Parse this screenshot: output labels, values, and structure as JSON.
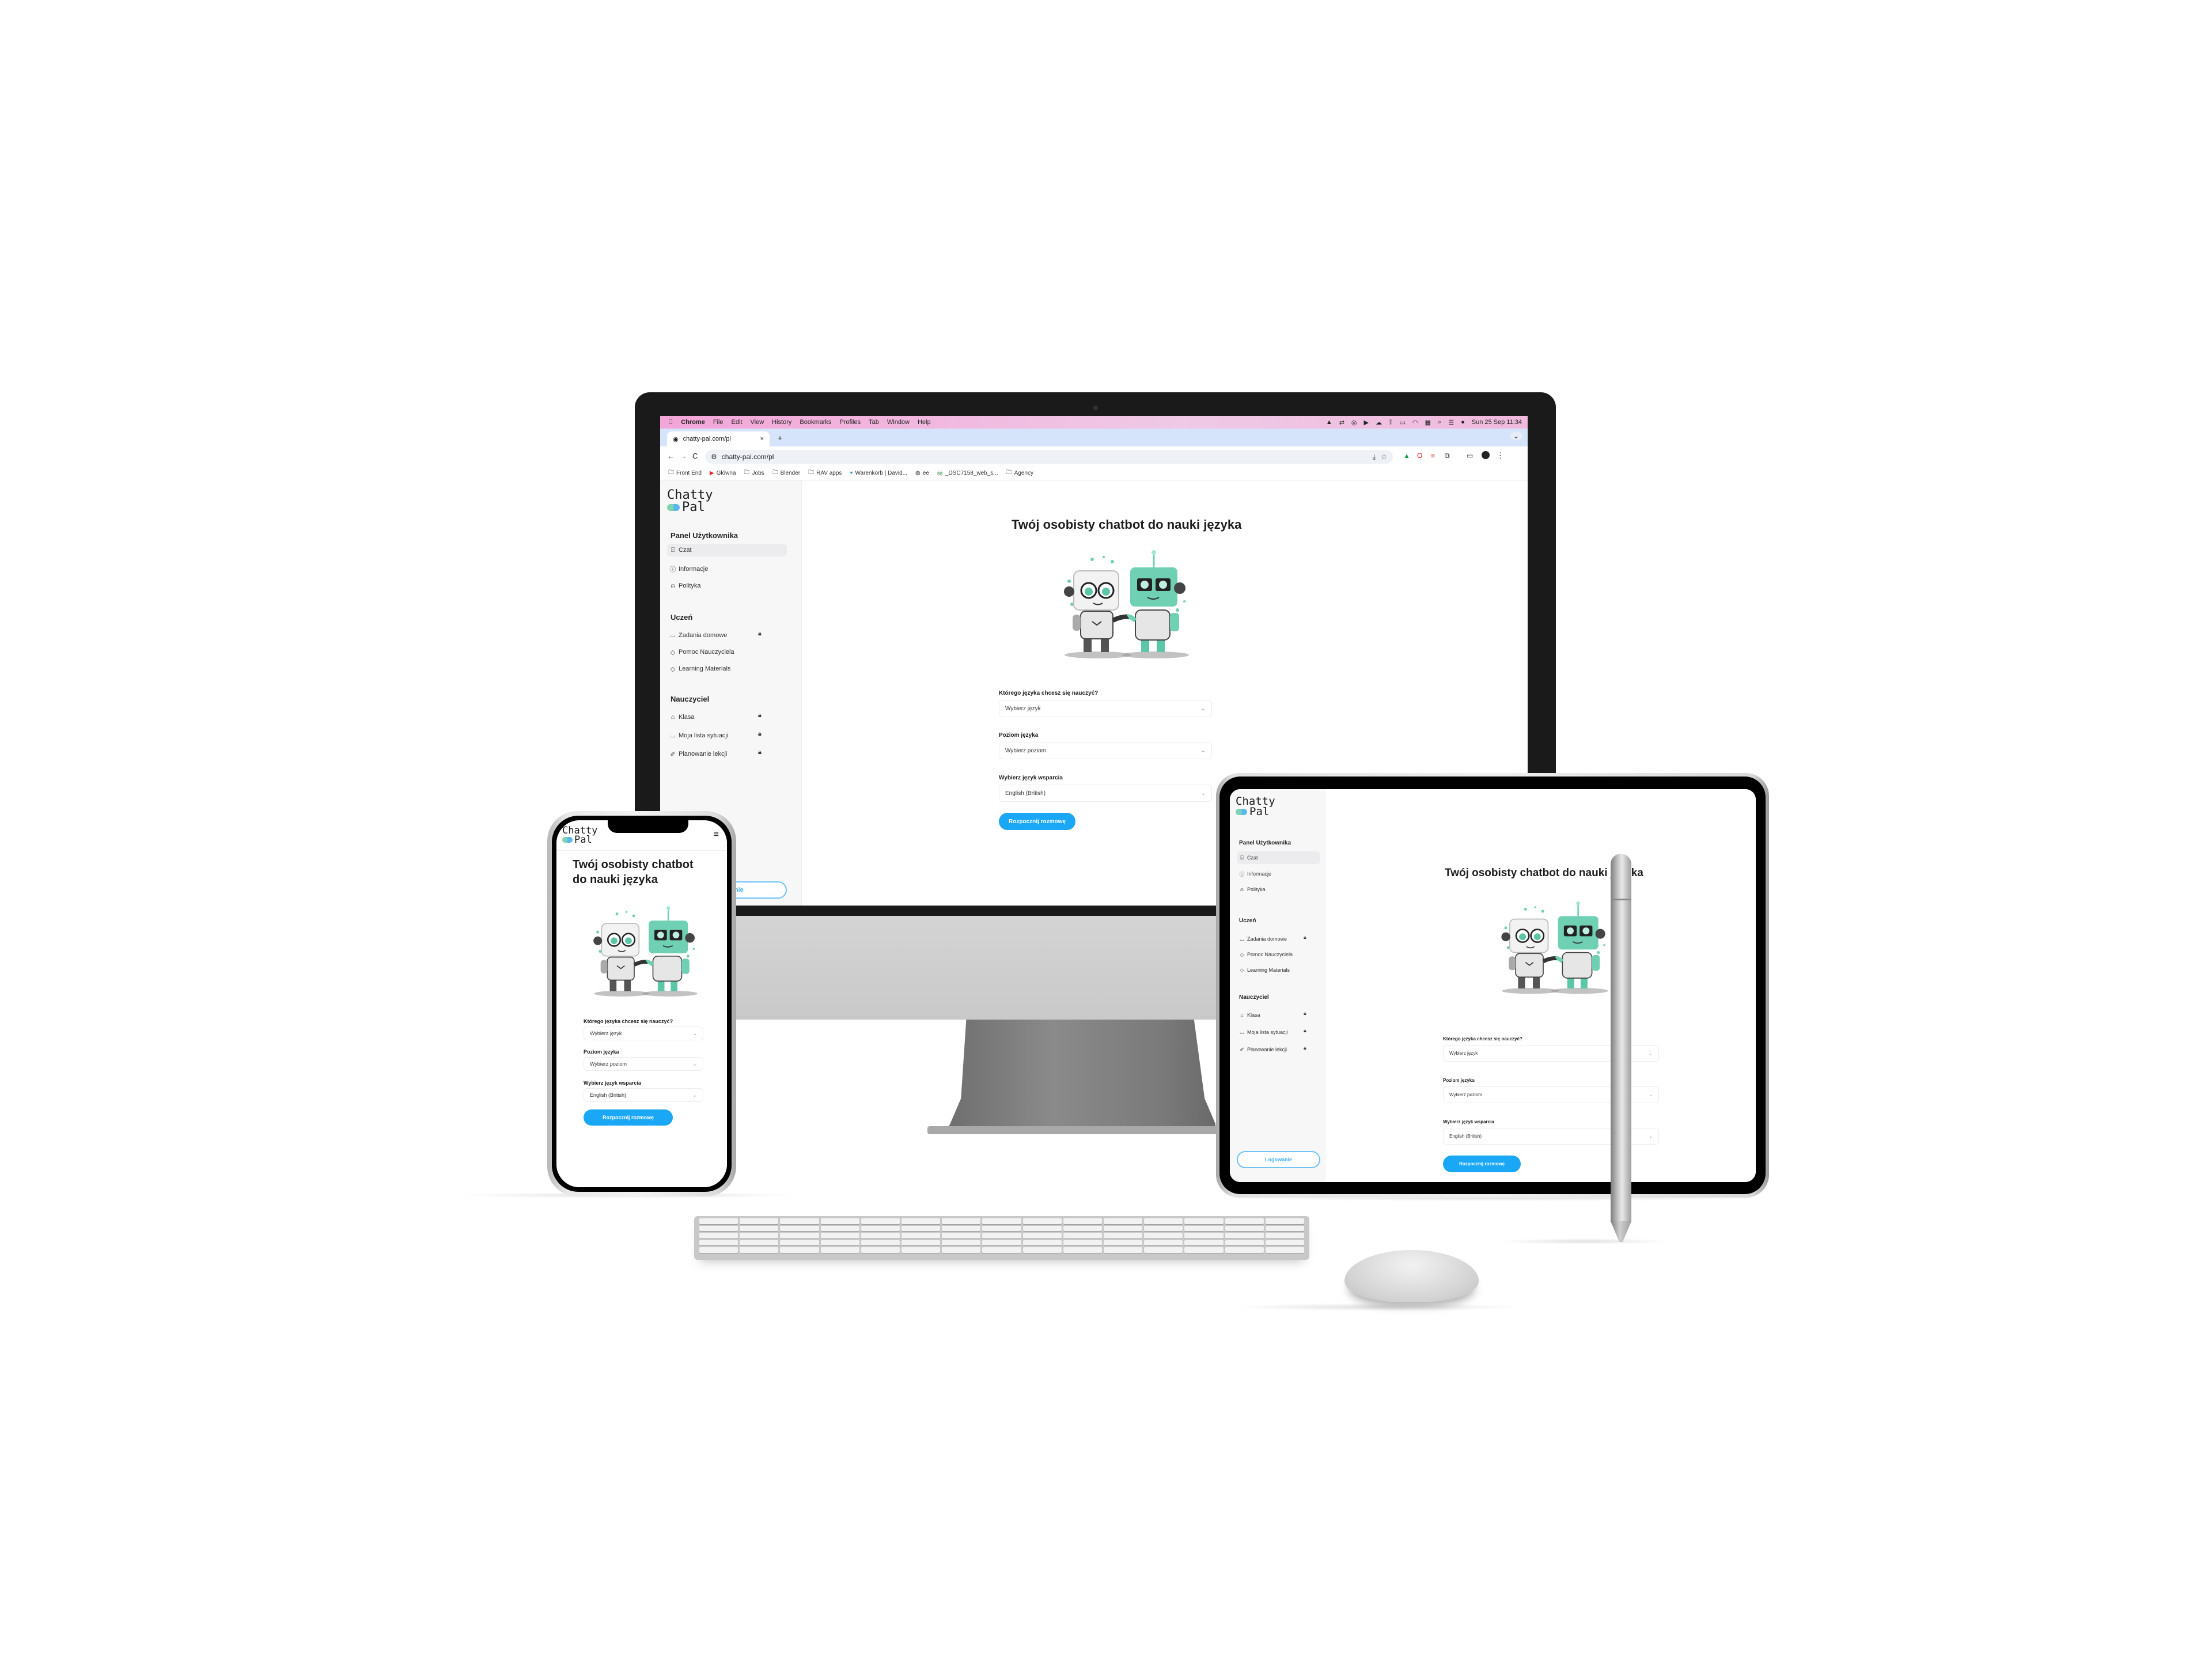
{
  "scene": "Responsive device mockup of Chatty Pal web app on desktop monitor, smartphone and tablet",
  "colors": {
    "accent_blue": "#1aa7f5",
    "outline_blue": "#6cc5f6",
    "logo_green": "#7fd3b0",
    "logo_blue": "#5ab8f0",
    "sidebar_bg": "#f7f7f8",
    "menubar_pink": "#f3a6d8",
    "tabbar_blue": "#d6e4fb"
  },
  "macos_menubar": {
    "apple_icon": "apple-icon",
    "items": [
      "Chrome",
      "File",
      "Edit",
      "View",
      "History",
      "Bookmarks",
      "Profiles",
      "Tab",
      "Window",
      "Help"
    ],
    "status_icons": [
      "drive-icon",
      "sync-icon",
      "creative-cloud-icon",
      "play-icon",
      "cloud-icon",
      "bluetooth-icon",
      "battery-icon",
      "wifi-icon",
      "keyboard-icon",
      "search-icon",
      "control-center-icon",
      "siri-icon"
    ],
    "datetime": "Sun 25 Sep  11:34"
  },
  "browser": {
    "tab_title": "chatty-pal.com/pl",
    "tab_close": "×",
    "new_tab": "+",
    "tab_list": "⌄",
    "url": "chatty-pal.com/pl",
    "nav": {
      "back": "←",
      "forward": "→",
      "reload": "C"
    },
    "bookmarks": [
      {
        "label": "Front End",
        "icon": "folder-icon"
      },
      {
        "label": "Główna",
        "icon": "youtube-icon"
      },
      {
        "label": "Jobs",
        "icon": "folder-icon"
      },
      {
        "label": "Blender",
        "icon": "folder-icon"
      },
      {
        "label": "RAV apps",
        "icon": "folder-icon"
      },
      {
        "label": "Warenkorb | David...",
        "icon": "cart-icon"
      },
      {
        "label": "ee",
        "icon": "globe-icon"
      },
      {
        "label": "_DSC7158_web_s...",
        "icon": "wordpress-icon"
      },
      {
        "label": "Agency",
        "icon": "folder-icon"
      }
    ]
  },
  "app": {
    "logo_line1": "Chatty",
    "logo_line2": "Pal",
    "sections": [
      {
        "title": "Panel Użytkownika",
        "items": [
          {
            "label": "Czat",
            "icon": "chat-icon",
            "active": true,
            "locked": false
          },
          {
            "label": "Informacje",
            "icon": "info-icon",
            "active": false,
            "locked": false
          },
          {
            "label": "Polityka",
            "icon": "siren-icon",
            "active": false,
            "locked": false
          }
        ]
      },
      {
        "title": "Uczeń",
        "items": [
          {
            "label": "Zadania domowe",
            "icon": "presentation-icon",
            "active": false,
            "locked": true
          },
          {
            "label": "Pomoc Nauczyciela",
            "icon": "graduation-cap-icon",
            "active": false,
            "locked": false
          },
          {
            "label": "Learning Materials",
            "icon": "graduation-cap-icon",
            "active": false,
            "locked": false
          }
        ]
      },
      {
        "title": "Nauczyciel",
        "items": [
          {
            "label": "Klasa",
            "icon": "school-icon",
            "active": false,
            "locked": true
          },
          {
            "label": "Moja lista sytuacji",
            "icon": "presentation-icon",
            "active": false,
            "locked": true
          },
          {
            "label": "Planowanie lekcji",
            "icon": "pencil-ruler-icon",
            "active": false,
            "locked": true
          }
        ]
      }
    ],
    "login_button": "Logowanie",
    "heading": "Twój osobisty chatbot do nauki języka",
    "heading_mobile_line1": "Twój osobisty chatbot",
    "heading_mobile_line2": "do nauki języka",
    "illustration": "two-robots-fist-bump-illustration",
    "form": {
      "language_label": "Którego języka chcesz się nauczyć?",
      "language_value": "Wybierz język",
      "level_label": "Poziom języka",
      "level_value": "Wybierz poziom",
      "support_label": "Wybierz język wsparcia",
      "support_value": "English (British)",
      "submit": "Rozpocznij rozmowę"
    },
    "mobile_menu_icon": "≡"
  }
}
